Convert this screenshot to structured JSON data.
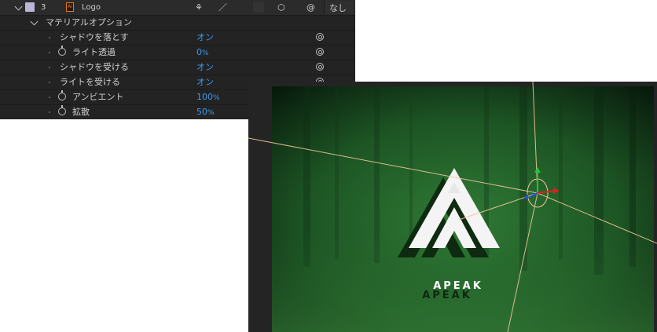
{
  "timeline": {
    "layer": {
      "number": "3",
      "badge": "Ai",
      "name": "Logo",
      "parent_value": "なし"
    },
    "group_label": "マテリアルオプション",
    "properties": [
      {
        "label": "シャドウを落とす",
        "value": "オン",
        "unit": "",
        "stopwatch": false
      },
      {
        "label": "ライト透過",
        "value": "0",
        "unit": "%",
        "stopwatch": true
      },
      {
        "label": "シャドウを受ける",
        "value": "オン",
        "unit": "",
        "stopwatch": false
      },
      {
        "label": "ライトを受ける",
        "value": "オン",
        "unit": "",
        "stopwatch": false
      },
      {
        "label": "アンビエント",
        "value": "100",
        "unit": "%",
        "stopwatch": true
      },
      {
        "label": "拡散",
        "value": "50",
        "unit": "%",
        "stopwatch": true
      }
    ],
    "value_color": "#3b9bf2"
  },
  "viewer": {
    "logo_text": "APEAK",
    "shadow_text": "APEAK",
    "background_color": "#1e5a26",
    "light_line_color": "#f3c79a",
    "axis_colors": {
      "x": "#e02020",
      "y": "#22c63a",
      "z": "#2a4bff"
    }
  }
}
